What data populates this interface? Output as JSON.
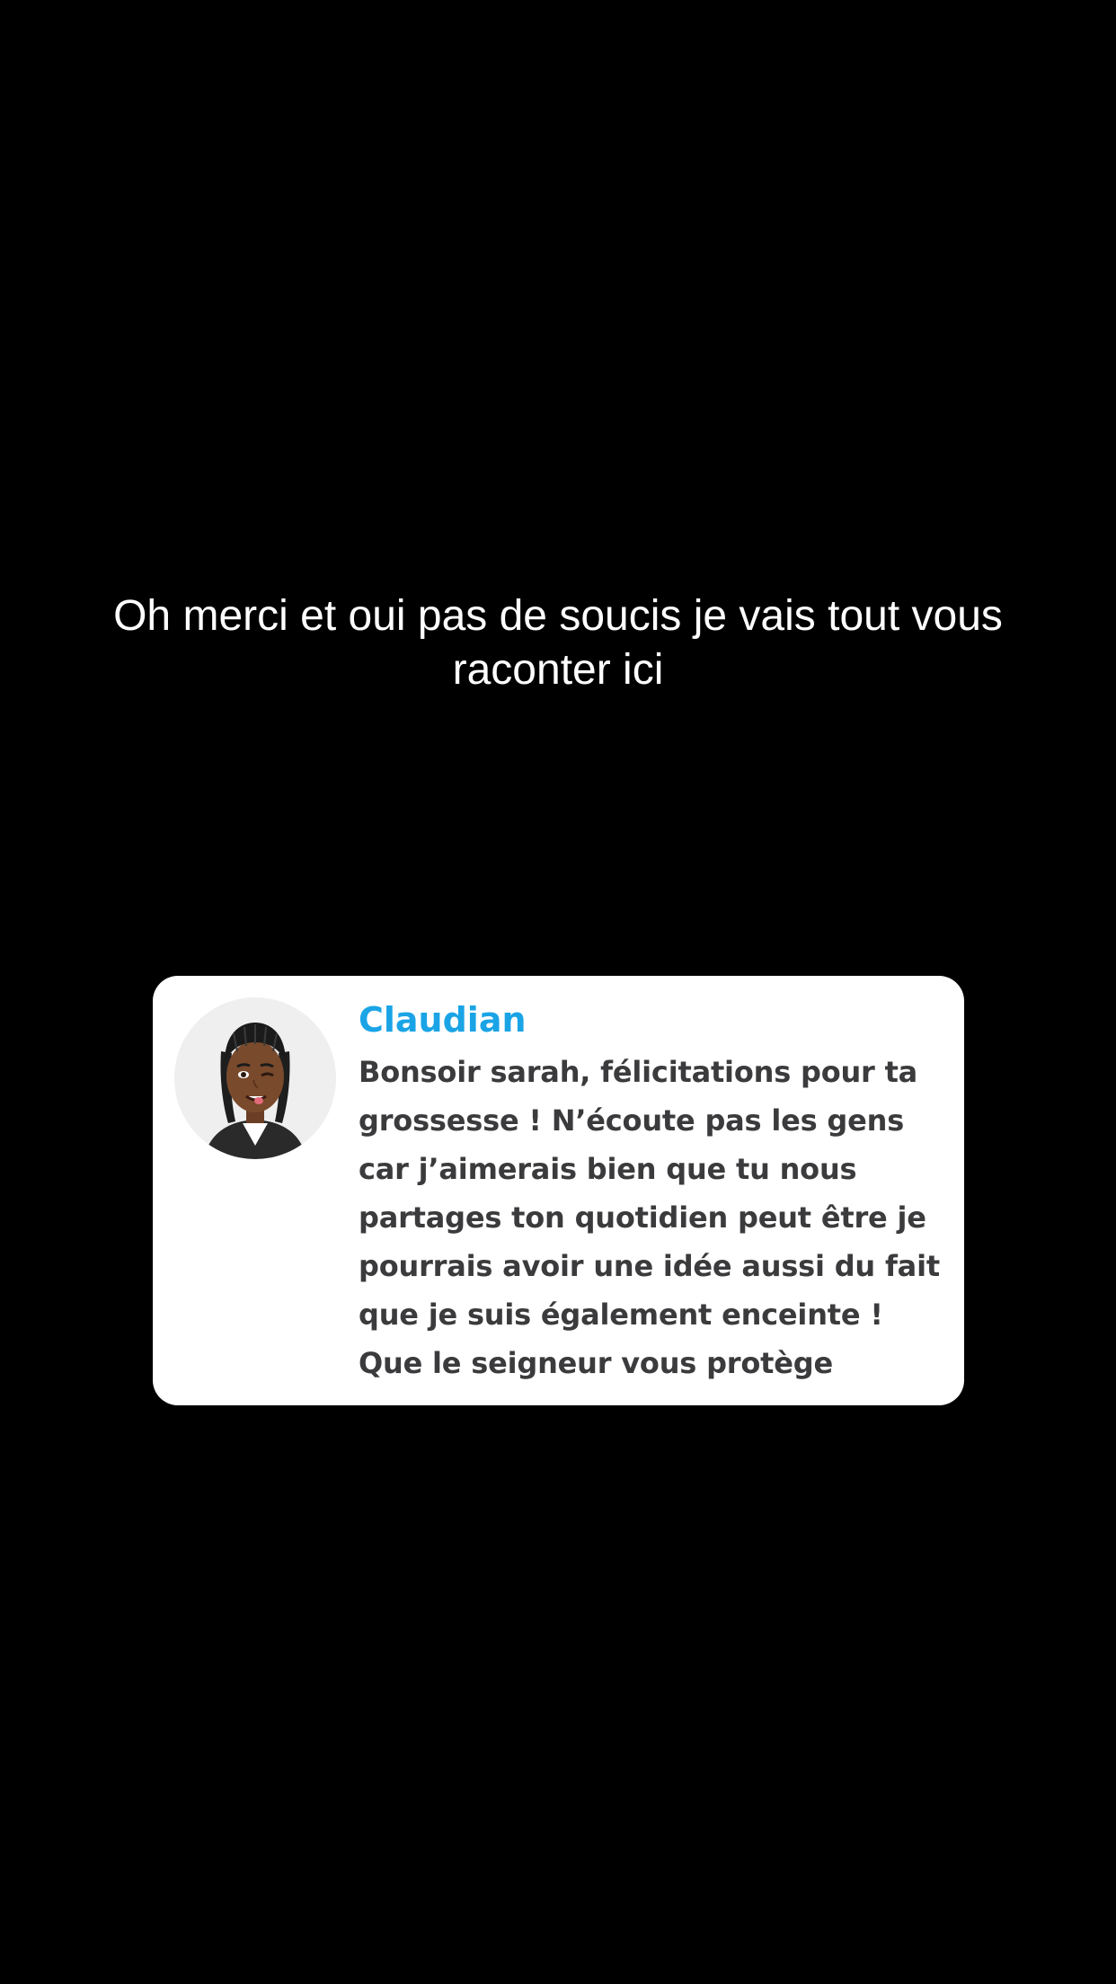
{
  "caption": {
    "text": "Oh merci et oui pas de soucis je vais tout vous raconter ici"
  },
  "comment_card": {
    "author": "Claudian",
    "message": "Bonsoir sarah, félicitations pour ta grossesse ! N’écoute pas les gens car j’aimerais bien que tu nous partages ton quotidien peut être je pourrais avoir une idée aussi du fait que je suis également enceinte ! Que le seigneur vous protège",
    "avatar_icon": "bitmoji-avatar-icon"
  },
  "colors": {
    "background": "#000000",
    "caption_text": "#ffffff",
    "card_background": "#ffffff",
    "author_name": "#1aa4e6",
    "message_text": "#3b3b3d"
  }
}
